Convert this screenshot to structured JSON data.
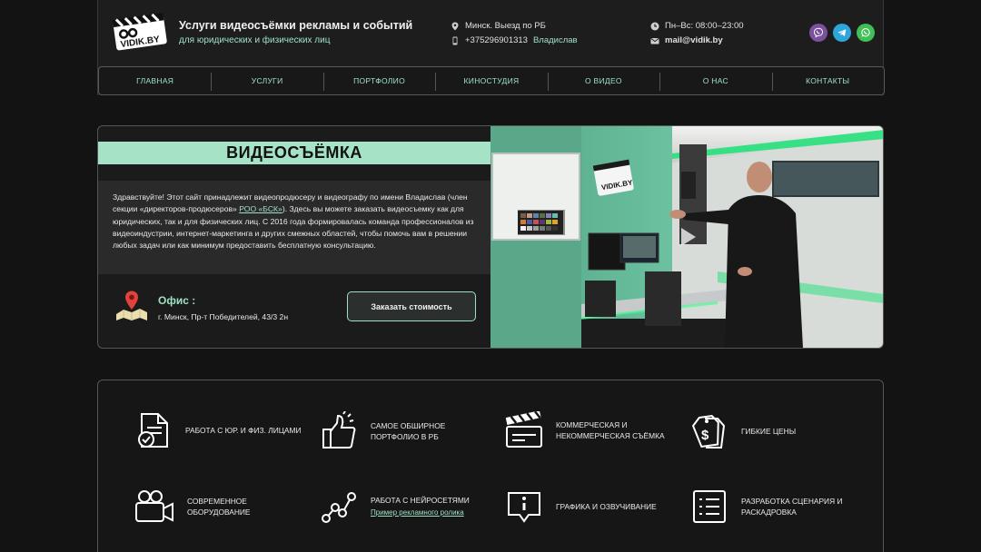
{
  "header": {
    "logo_text": "VIDIK.BY",
    "title": "Услуги видеосъёмки рекламы и событий",
    "subtitle": "для юридических и физических лиц",
    "location": "Минск. Выезд по РБ",
    "phone": "+375296901313",
    "phone_name": "Владислав",
    "hours": "Пн–Вс: 08:00–23:00",
    "email": "mail@vidik.by",
    "socials": [
      "viber-icon",
      "telegram-icon",
      "whatsapp-icon"
    ]
  },
  "nav": {
    "items": [
      "ГЛАВНАЯ",
      "УСЛУГИ",
      "ПОРТФОЛИО",
      "КИНОСТУДИЯ",
      "О ВИДЕО",
      "О НАС",
      "КОНТАКТЫ"
    ]
  },
  "hero": {
    "heading": "ВИДЕОСЪЁМКА",
    "text_before": "Здравствуйте! Этот сайт принадлежит видеопродюсеру и видеографу по имени Владислав (член секции «директоров-продюсеров» ",
    "text_link": "РОО «БСК»",
    "text_after": "). Здесь вы можете заказать видеосъемку как для юридических, так и для физических лиц. С 2016 года формировалась команда профессионалов из видеоиндустрии, интернет-маркетинга и других смежных областей, чтобы помочь вам в решении любых задач или как минимум предоставить бесплатную консультацию.",
    "office_title": "Офис :",
    "office_address": "г. Минск, Пр-т Победителей, 43/3 2н",
    "order_button": "Заказать стоимость"
  },
  "features": [
    {
      "icon": "document-check-icon",
      "label": "РАБОТА С ЮР. И ФИЗ. ЛИЦАМИ"
    },
    {
      "icon": "thumbs-up-icon",
      "label": "САМОЕ ОБШИРНОЕ ПОРТФОЛИО В РБ"
    },
    {
      "icon": "clapperboard-icon",
      "label": "КОММЕРЧЕСКАЯ И НЕКОММЕРЧЕСКАЯ СЪЁМКА"
    },
    {
      "icon": "price-tags-icon",
      "label": "ГИБКИЕ ЦЕНЫ"
    },
    {
      "icon": "video-camera-icon",
      "label": "СОВРЕМЕННОЕ ОБОРУДОВАНИЕ"
    },
    {
      "icon": "neural-network-icon",
      "label": "РАБОТА С НЕЙРОСЕТЯМИ",
      "link": "Пример рекламного ролика"
    },
    {
      "icon": "info-bubble-icon",
      "label": "ГРАФИКА И ОЗВУЧИВАНИЕ"
    },
    {
      "icon": "list-icon",
      "label": "РАЗРАБОТКА СЦЕНАРИЯ И РАСКАДРОВКА"
    }
  ],
  "colors": {
    "accent": "#9fe0c4",
    "band": "#a6e3c6",
    "background": "#131313",
    "panel": "#1d1d1d"
  }
}
